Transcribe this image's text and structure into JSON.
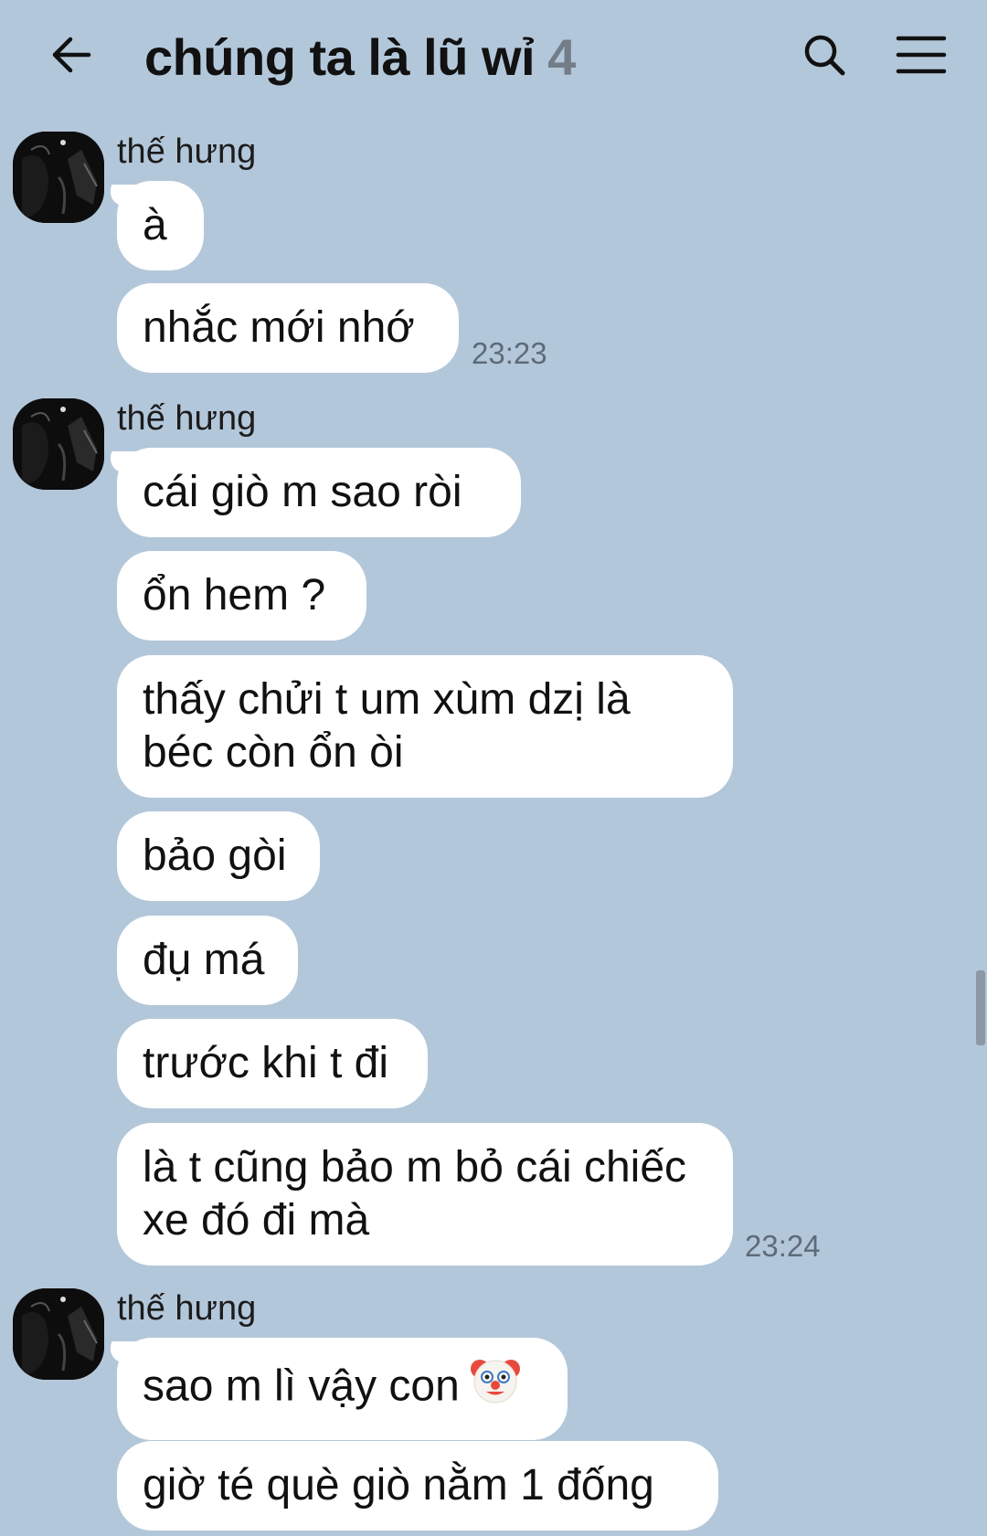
{
  "header": {
    "title": "chúng ta là lũ wỉ",
    "member_count": "4",
    "back_icon": "arrow-left-icon",
    "search_icon": "search-icon",
    "menu_icon": "hamburger-menu-icon"
  },
  "groups": [
    {
      "sender": "thế hưng",
      "messages": [
        "à",
        "nhắc mới nhớ"
      ],
      "time": "23:23"
    },
    {
      "sender": "thế hưng",
      "messages": [
        "cái giò m sao ròi",
        "ổn hem ?",
        "thấy chửi t um xùm dzị là béc còn ổn òi",
        "bảo gòi",
        "đụ má",
        "trước khi t đi",
        "là t cũng bảo m bỏ cái chiếc xe đó đi mà"
      ],
      "time": "23:24"
    },
    {
      "sender": "thế hưng",
      "messages": [
        "sao m lì vậy con",
        "giờ té què giò nằm 1 đống"
      ],
      "emoji": "clown-face-emoji"
    }
  ],
  "colors": {
    "background": "#b3c7da",
    "bubble": "#ffffff",
    "time": "#5e6b77",
    "count": "#737d88"
  }
}
